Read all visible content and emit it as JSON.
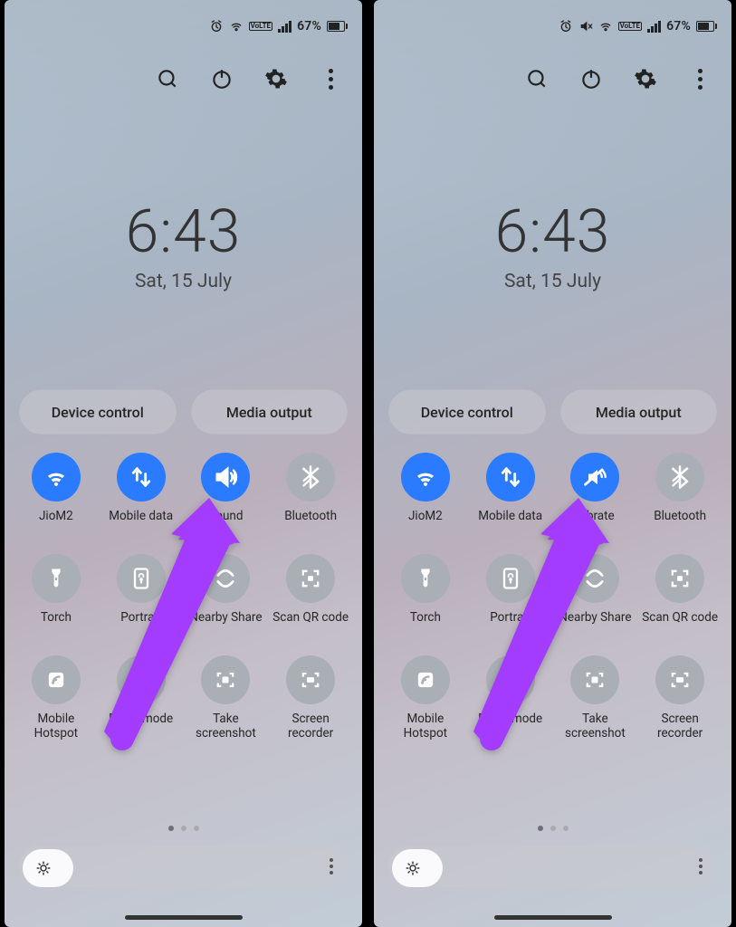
{
  "panels": [
    {
      "status": {
        "battery_text": "67%",
        "lte_label": "VoLTE"
      },
      "clock": {
        "time": "6:43",
        "date": "Sat, 15 July"
      },
      "pills": {
        "device_control": "Device control",
        "media_output": "Media output"
      },
      "tiles": [
        {
          "id": "wifi",
          "label": "JioM2",
          "icon": "wifi",
          "state": "on"
        },
        {
          "id": "data",
          "label": "Mobile data",
          "icon": "data",
          "state": "on"
        },
        {
          "id": "sound",
          "label": "Sound",
          "icon": "sound",
          "state": "on"
        },
        {
          "id": "bt",
          "label": "Bluetooth",
          "icon": "bluetooth",
          "state": "off"
        },
        {
          "id": "torch",
          "label": "Torch",
          "icon": "torch",
          "state": "off"
        },
        {
          "id": "portrait",
          "label": "Portrait",
          "icon": "lock",
          "state": "off"
        },
        {
          "id": "nearby",
          "label": "Nearby Share",
          "icon": "nearby",
          "state": "off"
        },
        {
          "id": "qr",
          "label": "Scan QR code",
          "icon": "qr",
          "state": "off"
        },
        {
          "id": "hotspot",
          "label": "Mobile Hotspot",
          "icon": "hotspot",
          "state": "off"
        },
        {
          "id": "flight",
          "label": "Flight mode",
          "icon": "flight",
          "state": "off"
        },
        {
          "id": "sshot",
          "label": "Take screenshot",
          "icon": "sshot",
          "state": "off"
        },
        {
          "id": "srec",
          "label": "Screen recorder",
          "icon": "srec",
          "state": "off"
        }
      ]
    },
    {
      "status": {
        "battery_text": "67%",
        "lte_label": "VoLTE"
      },
      "clock": {
        "time": "6:43",
        "date": "Sat, 15 July"
      },
      "pills": {
        "device_control": "Device control",
        "media_output": "Media output"
      },
      "tiles": [
        {
          "id": "wifi",
          "label": "JioM2",
          "icon": "wifi",
          "state": "on"
        },
        {
          "id": "data",
          "label": "Mobile data",
          "icon": "data",
          "state": "on"
        },
        {
          "id": "vibrate",
          "label": "Vibrate",
          "icon": "vibrate",
          "state": "on"
        },
        {
          "id": "bt",
          "label": "Bluetooth",
          "icon": "bluetooth",
          "state": "off"
        },
        {
          "id": "torch",
          "label": "Torch",
          "icon": "torch",
          "state": "off"
        },
        {
          "id": "portrait",
          "label": "Portrait",
          "icon": "lock",
          "state": "off"
        },
        {
          "id": "nearby",
          "label": "Nearby Share",
          "icon": "nearby",
          "state": "off"
        },
        {
          "id": "qr",
          "label": "Scan QR code",
          "icon": "qr",
          "state": "off"
        },
        {
          "id": "hotspot",
          "label": "Mobile Hotspot",
          "icon": "hotspot",
          "state": "off"
        },
        {
          "id": "flight",
          "label": "Flight mode",
          "icon": "flight",
          "state": "off"
        },
        {
          "id": "sshot",
          "label": "Take screenshot",
          "icon": "sshot",
          "state": "off"
        },
        {
          "id": "srec",
          "label": "Screen recorder",
          "icon": "srec",
          "state": "off"
        }
      ]
    }
  ],
  "colors": {
    "accent": "#2a7bff",
    "arrow": "#a43cff"
  }
}
